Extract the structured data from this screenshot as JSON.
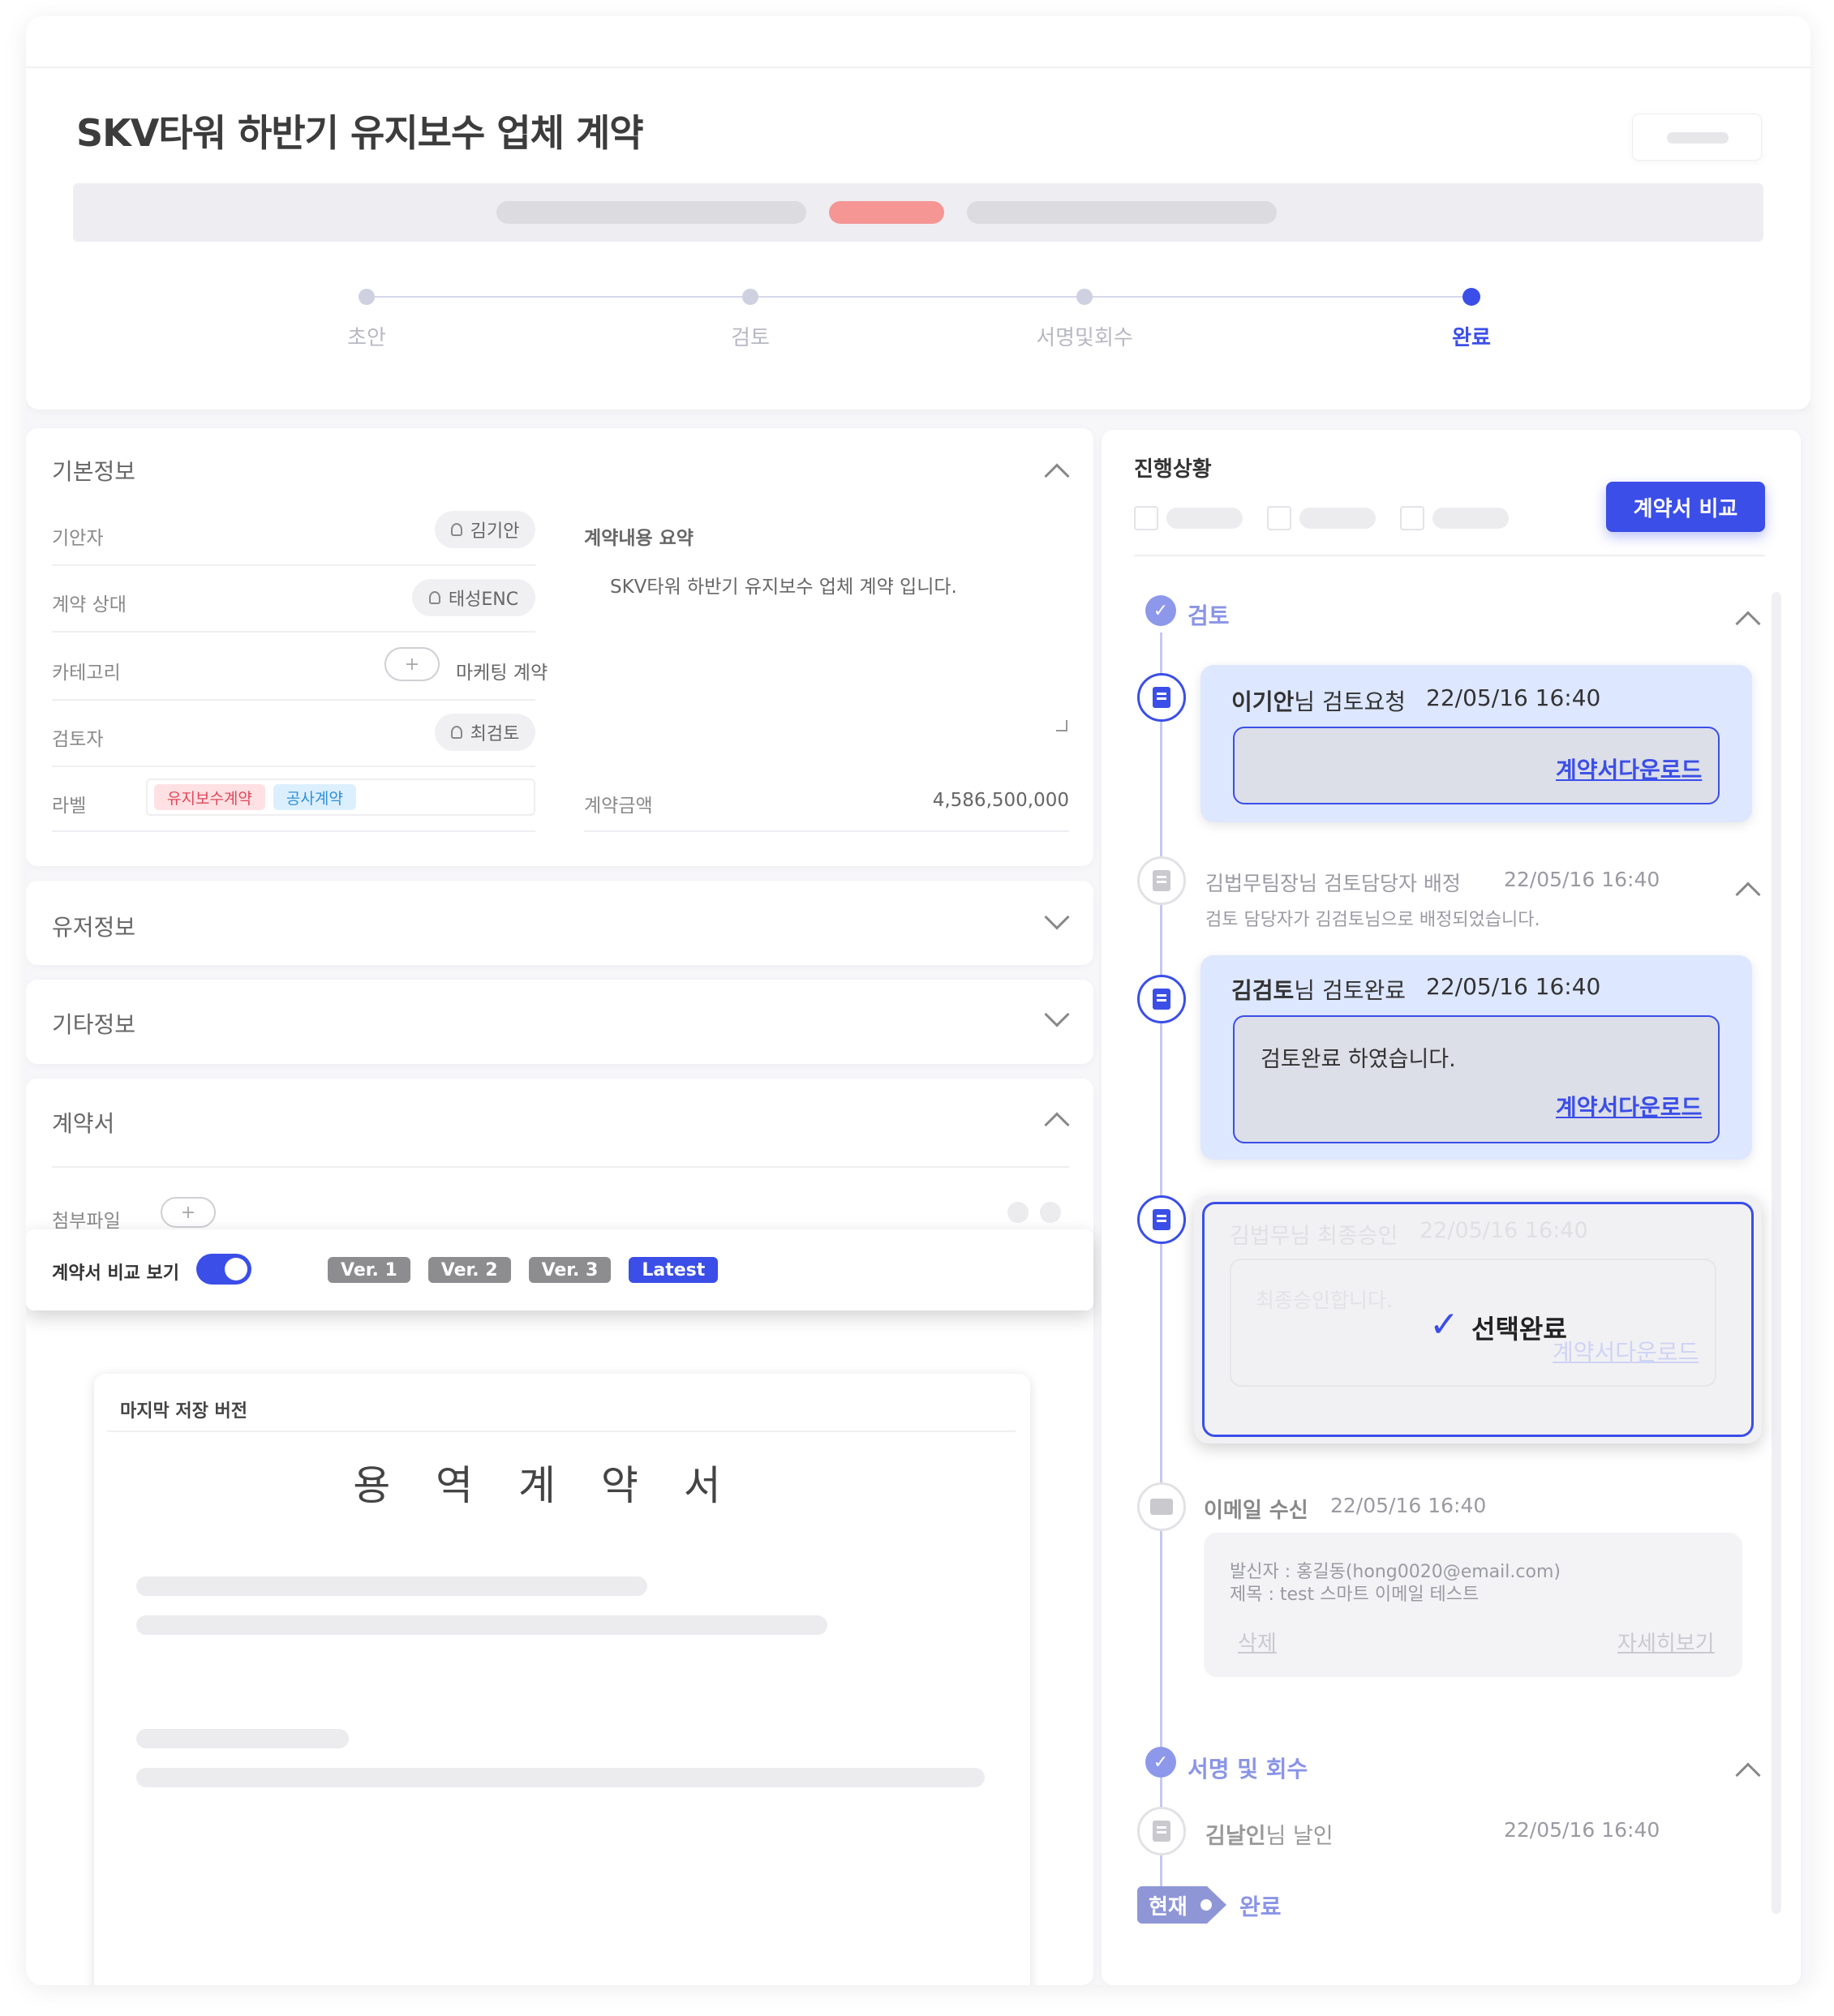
{
  "header": {
    "title": "SKV타워 하반기 유지보수 업체 계약",
    "steps": [
      {
        "label": "초안",
        "active": false
      },
      {
        "label": "검토",
        "active": false
      },
      {
        "label": "서명및회수",
        "active": false
      },
      {
        "label": "완료",
        "active": true
      }
    ]
  },
  "basic_info": {
    "title": "기본정보",
    "rows": {
      "drafter_label": "기안자",
      "drafter_value": "김기안",
      "counterparty_label": "계약 상대",
      "counterparty_value": "태성ENC",
      "category_label": "카테고리",
      "category_plus": "+",
      "category_value": "마케팅 계약",
      "reviewer_label": "검토자",
      "reviewer_value": "최검토",
      "label_label": "라벨",
      "tags": [
        "유지보수계약",
        "공사계약"
      ]
    },
    "summary_label": "계약내용 요약",
    "summary_text": "SKV타워 하반기 유지보수 업체 계약 입니다.",
    "amount_label": "계약금액",
    "amount_value": "4,586,500,000"
  },
  "user_info": {
    "title": "유저정보"
  },
  "other_info": {
    "title": "기타정보"
  },
  "contract": {
    "title": "계약서",
    "attachment_label": "첨부파일",
    "attachment_plus": "+",
    "compare_label": "계약서 비교 보기",
    "versions": [
      "Ver. 1",
      "Ver. 2",
      "Ver. 3",
      "Latest"
    ],
    "doc_header": "마지막 저장 버전",
    "doc_title": "용 역 계 약 서"
  },
  "progress": {
    "title": "진행상황",
    "compare_button": "계약서 비교",
    "phase_review": "검토",
    "events": {
      "e1_name": "이기안",
      "e1_suffix": "님 검토요청",
      "e1_time": "22/05/16 16:40",
      "e1_link": "계약서다운로드",
      "e2_title": "김법무팀장님 검토담당자 배정",
      "e2_time": "22/05/16 16:40",
      "e2_sub": "검토 담당자가 김검토님으로 배정되었습니다.",
      "e3_name": "김검토",
      "e3_suffix": "님 검토완료",
      "e3_time": "22/05/16 16:40",
      "e3_body": "검토완료 하였습니다.",
      "e3_link": "계약서다운로드",
      "e4_title": "김법무님 최종승인",
      "e4_time": "22/05/16 16:40",
      "e4_body": "최종승인합니다.",
      "e4_link": "계약서다운로드",
      "e4_overlay": "선택완료",
      "e5_title": "이메일 수신",
      "e5_time": "22/05/16 16:40",
      "e5_sender": "발신자 : 홍길동(hong0020@email.com)",
      "e5_subject": "제목 : test 스마트 이메일 테스트",
      "e5_delete": "삭제",
      "e5_detail": "자세히보기"
    },
    "phase_sign": "서명 및 회수",
    "sign_event": {
      "name": "김날인",
      "suffix": "님 날인",
      "time": "22/05/16 16:40"
    },
    "current_tag": "현재",
    "current_status": "완료"
  },
  "colors": {
    "accent": "#3b4ee8",
    "tag_red": "#e0475a",
    "tag_blue": "#2d8fd8"
  }
}
